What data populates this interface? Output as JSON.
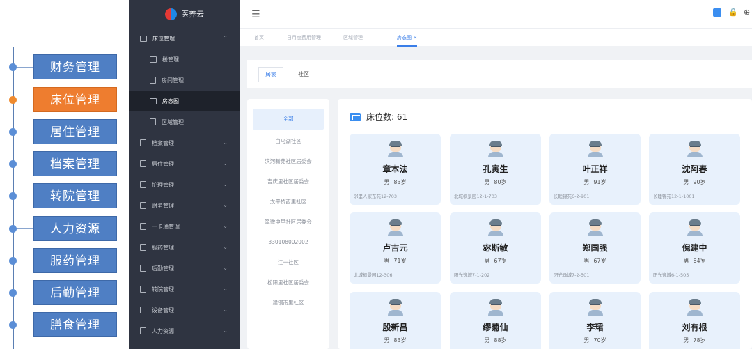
{
  "annotations": [
    {
      "label": "财务管理",
      "active": false
    },
    {
      "label": "床位管理",
      "active": true
    },
    {
      "label": "居住管理",
      "active": false
    },
    {
      "label": "档案管理",
      "active": false
    },
    {
      "label": "转院管理",
      "active": false
    },
    {
      "label": "人力资源",
      "active": false
    },
    {
      "label": "服药管理",
      "active": false
    },
    {
      "label": "后勤管理",
      "active": false
    },
    {
      "label": "膳食管理",
      "active": false
    }
  ],
  "brand": {
    "name": "医养云"
  },
  "sidebar": {
    "items": [
      {
        "label": "床位管理",
        "level": 1,
        "icon": "box-icon",
        "expanded": true
      },
      {
        "label": "楼管理",
        "level": 2,
        "icon": "box-icon"
      },
      {
        "label": "房间管理",
        "level": 2,
        "icon": "doc-icon"
      },
      {
        "label": "房态图",
        "level": 2,
        "icon": "box-icon",
        "current": true
      },
      {
        "label": "区域管理",
        "level": 2,
        "icon": "doc-icon"
      },
      {
        "label": "档案管理",
        "level": 1,
        "icon": "doc-icon"
      },
      {
        "label": "居住管理",
        "level": 1,
        "icon": "doc-icon"
      },
      {
        "label": "护理管理",
        "level": 1,
        "icon": "doc-icon"
      },
      {
        "label": "财务管理",
        "level": 1,
        "icon": "doc-icon"
      },
      {
        "label": "一卡通管理",
        "level": 1,
        "icon": "doc-icon"
      },
      {
        "label": "服药管理",
        "level": 1,
        "icon": "doc-icon"
      },
      {
        "label": "后勤管理",
        "level": 1,
        "icon": "doc-icon"
      },
      {
        "label": "转院管理",
        "level": 1,
        "icon": "doc-icon"
      },
      {
        "label": "设备管理",
        "level": 1,
        "icon": "doc-icon"
      },
      {
        "label": "人力资源",
        "level": 1,
        "icon": "doc-icon"
      }
    ]
  },
  "tabs": [
    {
      "label": "首页",
      "active": false
    },
    {
      "label": "日月度费用管理",
      "active": false
    },
    {
      "label": "区域管理",
      "active": false
    },
    {
      "label": "房态图 ×",
      "active": true
    }
  ],
  "filter_tabs": [
    {
      "label": "居家",
      "active": true
    },
    {
      "label": "社区",
      "active": false
    }
  ],
  "communities": [
    {
      "label": "全部",
      "active": true
    },
    {
      "label": "白马湖社区"
    },
    {
      "label": "滨河新苑社区居委会"
    },
    {
      "label": "吉庆里社区居委会"
    },
    {
      "label": "太平桥西里社区"
    },
    {
      "label": "翠微中里社区居委会"
    },
    {
      "label": "330108002002"
    },
    {
      "label": "江一社区"
    },
    {
      "label": "松阳里社区居委会"
    },
    {
      "label": "建钢南里社区"
    }
  ],
  "bed_count": {
    "label": "床位数: 61"
  },
  "residents": [
    {
      "name": "章本法",
      "gender": "男",
      "age": "83岁",
      "address": "邻里人家东苑12-703"
    },
    {
      "name": "孔寅生",
      "gender": "男",
      "age": "80岁",
      "address": "北城枫景园12-1-703"
    },
    {
      "name": "叶正祥",
      "gender": "男",
      "age": "91岁",
      "address": "长睦锦苑6-2-901"
    },
    {
      "name": "沈阿春",
      "gender": "男",
      "age": "90岁",
      "address": "长睦锦苑12-1-1001"
    },
    {
      "name": "卢吉元",
      "gender": "男",
      "age": "71岁",
      "address": "北城枫景园12-306"
    },
    {
      "name": "宓斯敏",
      "gender": "男",
      "age": "67岁",
      "address": "阳光逸城7-1-202"
    },
    {
      "name": "郑国强",
      "gender": "男",
      "age": "67岁",
      "address": "阳光逸城7-2-501"
    },
    {
      "name": "倪建中",
      "gender": "男",
      "age": "64岁",
      "address": "阳光逸城6-1-505"
    },
    {
      "name": "殷新昌",
      "gender": "男",
      "age": "83岁",
      "address": ""
    },
    {
      "name": "缪菊仙",
      "gender": "男",
      "age": "88岁",
      "address": ""
    },
    {
      "name": "李珺",
      "gender": "男",
      "age": "70岁",
      "address": ""
    },
    {
      "name": "刘有根",
      "gender": "男",
      "age": "78岁",
      "address": ""
    }
  ],
  "colors": {
    "accent": "#3a7ee8",
    "annotation_box": "#4f7fc4",
    "annotation_active": "#ee7d2f",
    "sidebar_bg": "#2f3441",
    "card_bg": "#e8f1fc"
  }
}
